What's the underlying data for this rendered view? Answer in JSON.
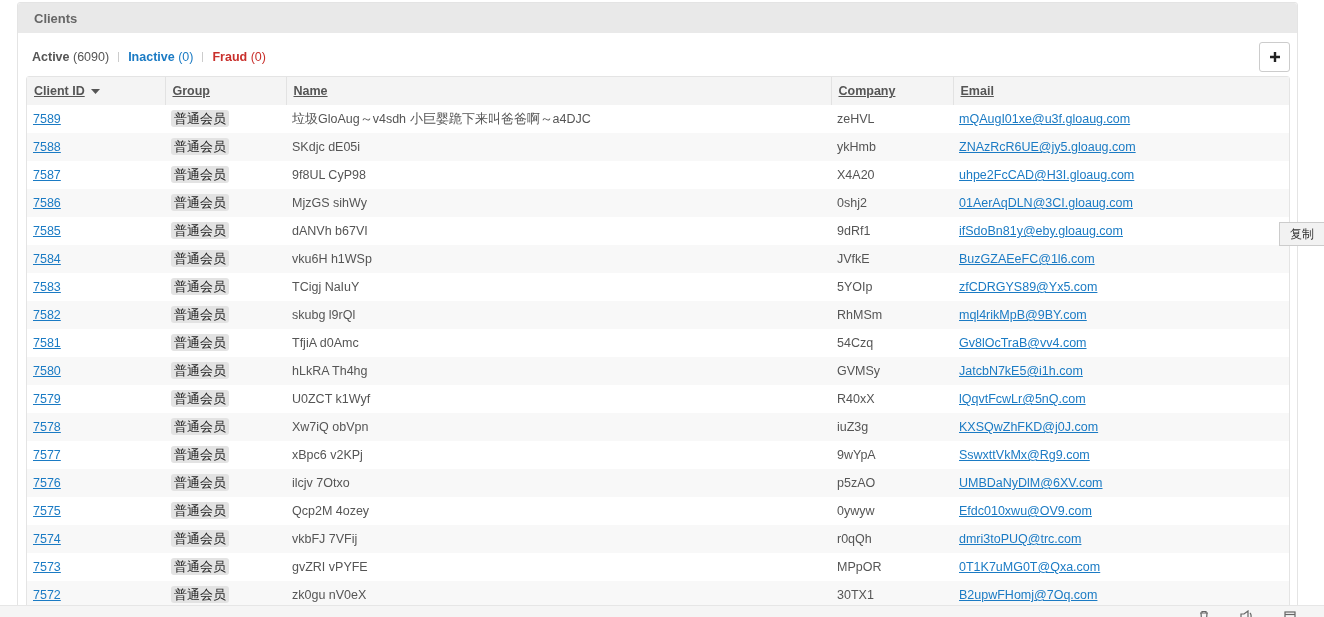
{
  "panel": {
    "title": "Clients"
  },
  "filters": [
    {
      "label": "Active",
      "count": "(6090)",
      "color": "#555555"
    },
    {
      "label": "Inactive",
      "count": "(0)",
      "color": "#1b7bc4"
    },
    {
      "label": "Fraud",
      "count": "(0)",
      "color": "#c9302c"
    }
  ],
  "table": {
    "columns": [
      {
        "label": "Client ID",
        "sorted": true
      },
      {
        "label": "Group",
        "sorted": false
      },
      {
        "label": "Name",
        "sorted": false
      },
      {
        "label": "Company",
        "sorted": false
      },
      {
        "label": "Email",
        "sorted": false
      }
    ],
    "rows": [
      {
        "id": "7589",
        "group": "普通会员",
        "name": "垃圾GloAug～v4sdh 小巨婴跪下来叫爸爸啊～a4DJC",
        "company": "zeHVL",
        "email": "mQAugI01xe@u3f.gloaug.com"
      },
      {
        "id": "7588",
        "group": "普通会员",
        "name": "SKdjc dE05i",
        "company": "ykHmb",
        "email": "ZNAzRcR6UE@jy5.gloaug.com"
      },
      {
        "id": "7587",
        "group": "普通会员",
        "name": "9f8UL CyP98",
        "company": "X4A20",
        "email": "uhpe2FcCAD@H3I.gloaug.com"
      },
      {
        "id": "7586",
        "group": "普通会员",
        "name": "MjzGS sihWy",
        "company": "0shj2",
        "email": "01AerAqDLN@3CI.gloaug.com"
      },
      {
        "id": "7585",
        "group": "普通会员",
        "name": "dANVh b67VI",
        "company": "9dRf1",
        "email": "ifSdoBn81y@eby.gloaug.com"
      },
      {
        "id": "7584",
        "group": "普通会员",
        "name": "vku6H h1WSp",
        "company": "JVfkE",
        "email": "BuzGZAEeFC@1l6.com"
      },
      {
        "id": "7583",
        "group": "普通会员",
        "name": "TCigj NaIuY",
        "company": "5YOIp",
        "email": "zfCDRGYS89@Yx5.com"
      },
      {
        "id": "7582",
        "group": "普通会员",
        "name": "skubg l9rQl",
        "company": "RhMSm",
        "email": "mql4rikMpB@9BY.com"
      },
      {
        "id": "7581",
        "group": "普通会员",
        "name": "TfjiA d0Amc",
        "company": "54Czq",
        "email": "Gv8lOcTraB@vv4.com"
      },
      {
        "id": "7580",
        "group": "普通会员",
        "name": "hLkRA Th4hg",
        "company": "GVMSy",
        "email": "JatcbN7kE5@i1h.com"
      },
      {
        "id": "7579",
        "group": "普通会员",
        "name": "U0ZCT k1Wyf",
        "company": "R40xX",
        "email": "lQqvtFcwLr@5nQ.com"
      },
      {
        "id": "7578",
        "group": "普通会员",
        "name": "Xw7iQ obVpn",
        "company": "iuZ3g",
        "email": "KXSQwZhFKD@j0J.com"
      },
      {
        "id": "7577",
        "group": "普通会员",
        "name": "xBpc6 v2KPj",
        "company": "9wYpA",
        "email": "SswxttVkMx@Rg9.com"
      },
      {
        "id": "7576",
        "group": "普通会员",
        "name": "ilcjv 7Otxo",
        "company": "p5zAO",
        "email": "UMBDaNyDlM@6XV.com"
      },
      {
        "id": "7575",
        "group": "普通会员",
        "name": "Qcp2M 4ozey",
        "company": "0ywyw",
        "email": "Efdc010xwu@OV9.com"
      },
      {
        "id": "7574",
        "group": "普通会员",
        "name": "vkbFJ 7VFij",
        "company": "r0qQh",
        "email": "dmri3toPUQ@trc.com"
      },
      {
        "id": "7573",
        "group": "普通会员",
        "name": "gvZRI vPYFE",
        "company": "MPpOR",
        "email": "0T1K7uMG0T@Qxa.com"
      },
      {
        "id": "7572",
        "group": "普通会员",
        "name": "zk0gu nV0eX",
        "company": "30TX1",
        "email": "B2upwFHomj@7Oq.com"
      }
    ]
  },
  "copy_popup": {
    "label": "复制"
  }
}
